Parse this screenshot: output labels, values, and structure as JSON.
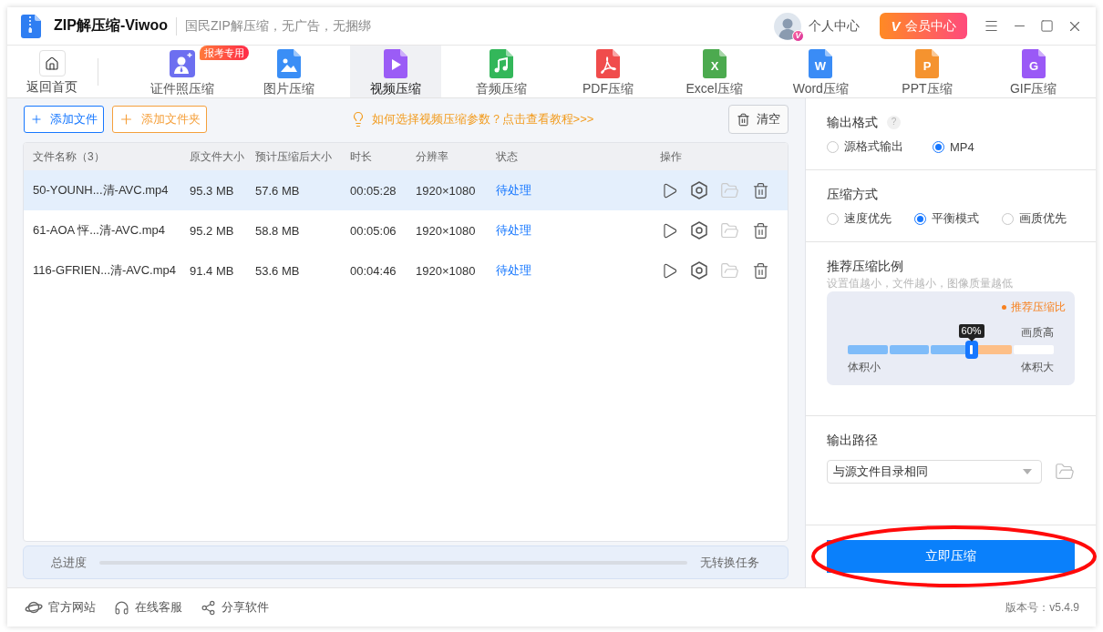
{
  "window": {
    "title": "ZIP解压缩-Viwoo",
    "subtitle": "国民ZIP解压缩，无广告，无捆绑"
  },
  "account": {
    "label": "个人中心",
    "badge": "V"
  },
  "vip_button": {
    "icon_text": "V",
    "label": "会员中心"
  },
  "home": {
    "label": "返回首页"
  },
  "tabs": [
    {
      "kind": "id_photo",
      "label": "证件照压缩",
      "color": "#6d6ff0",
      "badge": "报考专用",
      "selected": false
    },
    {
      "kind": "image",
      "label": "图片压缩",
      "color": "#3a8ef6",
      "selected": false
    },
    {
      "kind": "video",
      "label": "视频压缩",
      "color": "#9b5cf6",
      "selected": true
    },
    {
      "kind": "audio",
      "label": "音频压缩",
      "color": "#33b75a",
      "selected": false
    },
    {
      "kind": "pdf",
      "label": "PDF压缩",
      "color": "#f04c4c",
      "selected": false
    },
    {
      "kind": "letter",
      "icon_text": "X",
      "label": "Excel压缩",
      "color": "#4caa4f",
      "selected": false
    },
    {
      "kind": "letter",
      "icon_text": "W",
      "label": "Word压缩",
      "color": "#3a8cf6",
      "selected": false
    },
    {
      "kind": "letter",
      "icon_text": "P",
      "label": "PPT压缩",
      "color": "#f5932f",
      "selected": false
    },
    {
      "kind": "letter",
      "icon_text": "G",
      "label": "GIF压缩",
      "color": "#9a59f6",
      "selected": false
    }
  ],
  "file_actions": {
    "add_file": "添加文件",
    "add_folder": "添加文件夹",
    "tutorial_link": "如何选择视频压缩参数？点击查看教程>>>",
    "clear": "清空"
  },
  "table": {
    "columns": [
      "文件名称（3）",
      "原文件大小",
      "预计压缩后大小",
      "时长",
      "分辨率",
      "状态",
      "操作"
    ],
    "rows": [
      {
        "name": "50-YOUNH...清-AVC.mp4",
        "size": "95.3 MB",
        "estimated": "57.6 MB",
        "duration": "00:05:28",
        "resolution": "1920×1080",
        "status": "待处理",
        "selected": true,
        "folder_disabled": true
      },
      {
        "name": "61-AOA 怦...清-AVC.mp4",
        "size": "95.2 MB",
        "estimated": "58.8 MB",
        "duration": "00:05:06",
        "resolution": "1920×1080",
        "status": "待处理",
        "selected": false,
        "folder_disabled": true
      },
      {
        "name": "116-GFRIEN...清-AVC.mp4",
        "size": "91.4 MB",
        "estimated": "53.6 MB",
        "duration": "00:04:46",
        "resolution": "1920×1080",
        "status": "待处理",
        "selected": false,
        "folder_disabled": true
      }
    ]
  },
  "progress": {
    "label": "总进度",
    "status": "无转换任务"
  },
  "output_format": {
    "title": "输出格式",
    "help": "?",
    "options": [
      {
        "label": "源格式输出",
        "selected": false
      },
      {
        "label": "MP4",
        "selected": true
      }
    ]
  },
  "compression_mode": {
    "title": "压缩方式",
    "options": [
      {
        "label": "速度优先",
        "selected": false
      },
      {
        "label": "平衡模式",
        "selected": true
      },
      {
        "label": "画质优先",
        "selected": false
      }
    ]
  },
  "ratio": {
    "title": "推荐压缩比例",
    "hint": "设置值越小，文件越小，图像质量越低",
    "legend": "推荐压缩比",
    "tooltip": "60%",
    "level": 0.6,
    "high_label": "画质高",
    "min_label": "体积小",
    "max_label": "体积大"
  },
  "output_path": {
    "title": "输出路径",
    "value": "与源文件目录相同"
  },
  "compress_button": "立即压缩",
  "highlight": {
    "kind": "ellipse"
  },
  "footer": {
    "links": [
      {
        "kind": "website",
        "label": "官方网站"
      },
      {
        "kind": "support",
        "label": "在线客服"
      },
      {
        "kind": "share",
        "label": "分享软件"
      }
    ],
    "version": "版本号：v5.4.9"
  }
}
